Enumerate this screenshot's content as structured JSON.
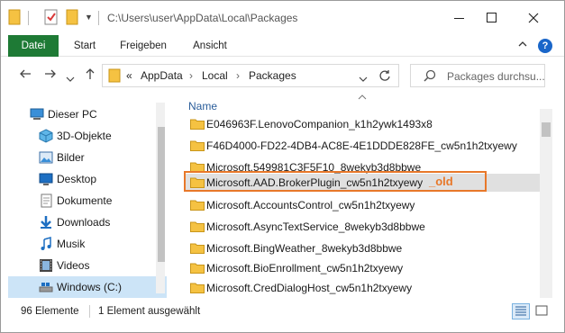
{
  "window": {
    "title_path": "C:\\Users\\user\\AppData\\Local\\Packages"
  },
  "ribbon": {
    "tabs": [
      "Datei",
      "Start",
      "Freigeben",
      "Ansicht"
    ],
    "help": "?"
  },
  "address": {
    "crumbs": [
      "AppData",
      "Local",
      "Packages"
    ],
    "separator": "›",
    "overflow": "«"
  },
  "search": {
    "placeholder": "Packages durchsu..."
  },
  "sidebar": {
    "items": [
      {
        "label": "Dieser PC",
        "icon": "pc-icon"
      },
      {
        "label": "3D-Objekte",
        "icon": "cube-icon"
      },
      {
        "label": "Bilder",
        "icon": "pictures-icon"
      },
      {
        "label": "Desktop",
        "icon": "desktop-icon"
      },
      {
        "label": "Dokumente",
        "icon": "documents-icon"
      },
      {
        "label": "Downloads",
        "icon": "download-icon"
      },
      {
        "label": "Musik",
        "icon": "music-icon"
      },
      {
        "label": "Videos",
        "icon": "video-icon"
      },
      {
        "label": "Windows (C:)",
        "icon": "drive-icon",
        "selected": true
      }
    ]
  },
  "list": {
    "column_name": "Name",
    "items": [
      "E046963F.LenovoCompanion_k1h2ywk1493x8",
      "F46D4000-FD22-4DB4-AC8E-4E1DDDE828FE_cw5n1h2txyewy",
      "Microsoft.549981C3F5F10_8wekyb3d8bbwe",
      "Microsoft.AAD.BrokerPlugin_cw5n1h2txyewy",
      "Microsoft.AccountsControl_cw5n1h2txyewy",
      "Microsoft.AsyncTextService_8wekyb3d8bbwe",
      "Microsoft.BingWeather_8wekyb3d8bbwe",
      "Microsoft.BioEnrollment_cw5n1h2txyewy",
      "Microsoft.CredDialogHost_cw5n1h2txyewy"
    ],
    "highlighted_index": 3,
    "annotation": "_old",
    "annotation_color": "#e8782a"
  },
  "status": {
    "count": "96 Elemente",
    "selection": "1 Element ausgewählt"
  },
  "colors": {
    "file_tab": "#1e7a35",
    "folder": "#f5c242",
    "selection": "#cce4f7"
  }
}
